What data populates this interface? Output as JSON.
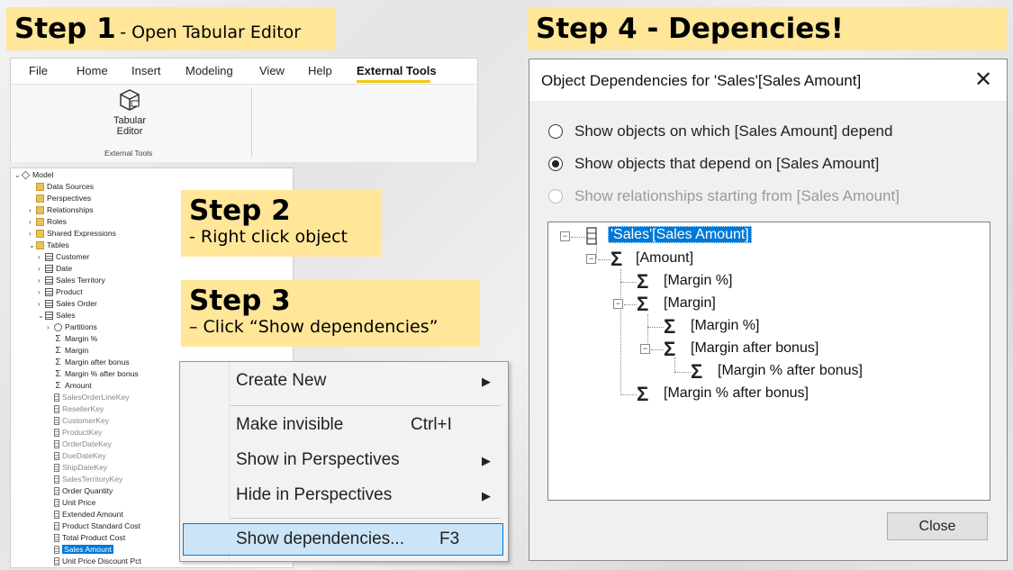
{
  "step1": {
    "title": "Step 1",
    "subtitle": "- Open Tabular Editor"
  },
  "step2": {
    "title": "Step 2",
    "subtitle": "- Right click object"
  },
  "step3": {
    "title": "Step 3",
    "subtitle": "– Click “Show dependencies”"
  },
  "step4": {
    "title": "Step 4 - Depencies!"
  },
  "ribbon": {
    "tabs": [
      "File",
      "Home",
      "Insert",
      "Modeling",
      "View",
      "Help",
      "External Tools"
    ],
    "active_tab": "External Tools",
    "button_label_line1": "Tabular",
    "button_label_line2": "Editor",
    "group_label": "External Tools"
  },
  "tree": {
    "items": [
      "Model",
      "Data Sources",
      "Perspectives",
      "Relationships",
      "Roles",
      "Shared Expressions",
      "Tables",
      "Customer",
      "Date",
      "Sales Territory",
      "Product",
      "Sales Order",
      "Sales",
      "Partitions",
      "Margin %",
      "Margin",
      "Margin after bonus",
      "Margin % after bonus",
      "Amount",
      "SalesOrderLineKey",
      "ResellerKey",
      "CustomerKey",
      "ProductKey",
      "OrderDateKey",
      "DueDateKey",
      "ShipDateKey",
      "SalesTerritoryKey",
      "Order Quantity",
      "Unit Price",
      "Extended Amount",
      "Product Standard Cost",
      "Total Product Cost",
      "Sales Amount",
      "Unit Price Discount Pct"
    ]
  },
  "context_menu": {
    "create_new": "Create New",
    "make_invisible": "Make invisible",
    "make_invisible_shortcut": "Ctrl+I",
    "show_in_perspectives": "Show in Perspectives",
    "hide_in_perspectives": "Hide in Perspectives",
    "show_dependencies": "Show dependencies...",
    "show_dependencies_shortcut": "F3"
  },
  "dialog": {
    "title": "Object Dependencies for 'Sales'[Sales Amount]",
    "option1": "Show objects on which [Sales Amount] depend",
    "option2": "Show objects that depend on [Sales Amount]",
    "option3": "Show relationships starting from [Sales Amount]",
    "selected_option": 2,
    "nodes": {
      "root": "'Sales'[Sales Amount]",
      "n1": "[Amount]",
      "n2": "[Margin %]",
      "n3": "[Margin]",
      "n4": "[Margin %]",
      "n5": "[Margin after bonus]",
      "n6": "[Margin % after bonus]",
      "n7": "[Margin % after bonus]"
    },
    "close_label": "Close"
  }
}
